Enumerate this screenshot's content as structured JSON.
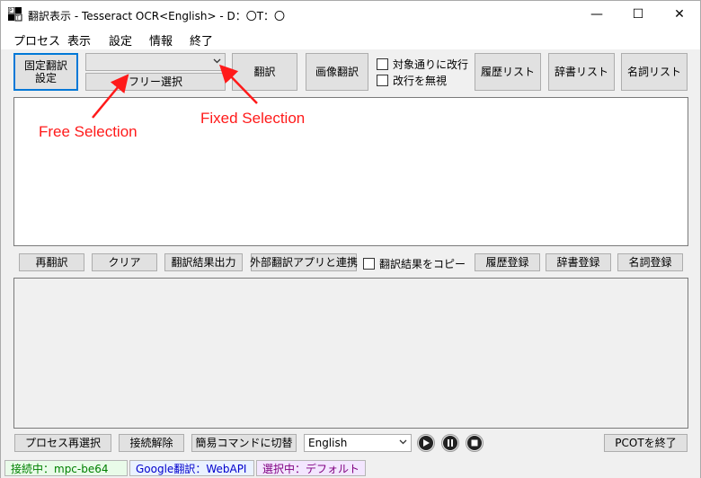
{
  "window": {
    "title": "翻訳表示 - Tesseract OCR<English> - D：〇T：〇",
    "minimize": "—",
    "maximize": "☐",
    "close": "✕"
  },
  "menu": [
    "プロセス",
    "表示",
    "設定",
    "情報",
    "終了"
  ],
  "toolbar": {
    "fixed_translate_settings": "固定翻訳\n設定",
    "region_select_value": "",
    "free_select": "フリー選択",
    "translate": "翻訳",
    "image_translate": "画像翻訳",
    "line_break_check": "対象通りに改行",
    "ignore_line_break_check": "改行を無視",
    "history_list": "履歴リスト",
    "dictionary_list": "辞書リスト",
    "noun_list": "名詞リスト"
  },
  "source_text": "",
  "middle_bar": {
    "retranslate": "再翻訳",
    "clear": "クリア",
    "export_result": "翻訳結果出力",
    "external_app": "外部翻訳アプリと連携",
    "copy_result_check": "翻訳結果をコピー",
    "register_history": "履歴登録",
    "register_dictionary": "辞書登録",
    "register_noun": "名詞登録"
  },
  "result_text": "",
  "bottom_bar": {
    "reselect_process": "プロセス再選択",
    "disconnect": "接続解除",
    "switch_simple_command": "簡易コマンドに切替",
    "language_value": "English",
    "quit_pcot": "PCOTを終了"
  },
  "status": {
    "connection": "接続中：mpc-be64",
    "translator": "Google翻訳：WebAPI",
    "selection": "選択中：デフォルト",
    "connection_color": "#008000",
    "translator_color": "#0000cc",
    "selection_color": "#800080",
    "connection_bg": "#e9fbe9",
    "translator_bg": "#eaf2ff",
    "selection_bg": "#f3e6ff"
  },
  "annotations": {
    "free_selection": "Free Selection",
    "fixed_selection": "Fixed Selection",
    "color": "#ff1a1a"
  },
  "icons": [
    "app-icon",
    "minimize-icon",
    "maximize-icon",
    "close-icon",
    "chevron-down-icon",
    "play-icon",
    "pause-icon",
    "stop-icon"
  ]
}
